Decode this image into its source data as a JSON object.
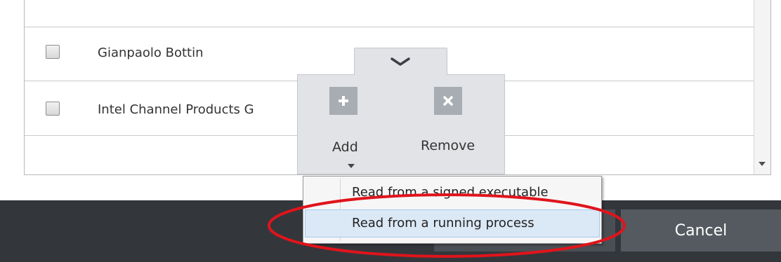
{
  "list": {
    "rows": [
      {
        "label": "",
        "checked": false
      },
      {
        "label": "Gianpaolo Bottin",
        "checked": false
      },
      {
        "label": "Intel Channel Products G",
        "checked": false
      },
      {
        "label": "",
        "checked": false
      }
    ]
  },
  "toolbar": {
    "add_label": "Add",
    "remove_label": "Remove",
    "icon_bg": "#a8adb3",
    "panel_bg": "#e1e3e6"
  },
  "add_menu": {
    "items": [
      {
        "label": "Read from a signed executable",
        "highlighted": false
      },
      {
        "label": "Read from a running process",
        "highlighted": true
      }
    ]
  },
  "footer": {
    "cancel_label": "Cancel",
    "bar_color": "#33373c",
    "button_color": "#555a60"
  },
  "annotation": {
    "color": "#e0141b"
  }
}
